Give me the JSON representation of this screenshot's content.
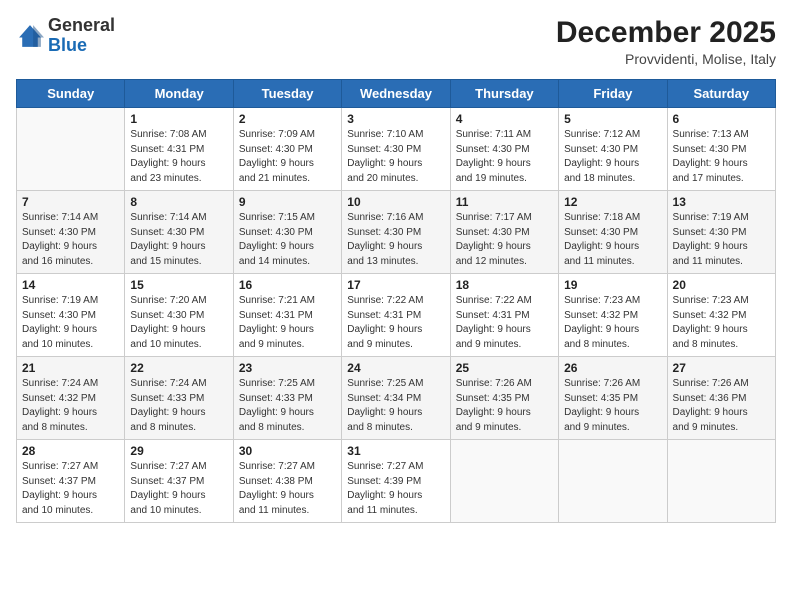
{
  "header": {
    "logo_general": "General",
    "logo_blue": "Blue",
    "month_title": "December 2025",
    "subtitle": "Provvidenti, Molise, Italy"
  },
  "days_of_week": [
    "Sunday",
    "Monday",
    "Tuesday",
    "Wednesday",
    "Thursday",
    "Friday",
    "Saturday"
  ],
  "weeks": [
    [
      {
        "day": "",
        "info": ""
      },
      {
        "day": "1",
        "info": "Sunrise: 7:08 AM\nSunset: 4:31 PM\nDaylight: 9 hours\nand 23 minutes."
      },
      {
        "day": "2",
        "info": "Sunrise: 7:09 AM\nSunset: 4:30 PM\nDaylight: 9 hours\nand 21 minutes."
      },
      {
        "day": "3",
        "info": "Sunrise: 7:10 AM\nSunset: 4:30 PM\nDaylight: 9 hours\nand 20 minutes."
      },
      {
        "day": "4",
        "info": "Sunrise: 7:11 AM\nSunset: 4:30 PM\nDaylight: 9 hours\nand 19 minutes."
      },
      {
        "day": "5",
        "info": "Sunrise: 7:12 AM\nSunset: 4:30 PM\nDaylight: 9 hours\nand 18 minutes."
      },
      {
        "day": "6",
        "info": "Sunrise: 7:13 AM\nSunset: 4:30 PM\nDaylight: 9 hours\nand 17 minutes."
      }
    ],
    [
      {
        "day": "7",
        "info": "Sunrise: 7:14 AM\nSunset: 4:30 PM\nDaylight: 9 hours\nand 16 minutes."
      },
      {
        "day": "8",
        "info": "Sunrise: 7:14 AM\nSunset: 4:30 PM\nDaylight: 9 hours\nand 15 minutes."
      },
      {
        "day": "9",
        "info": "Sunrise: 7:15 AM\nSunset: 4:30 PM\nDaylight: 9 hours\nand 14 minutes."
      },
      {
        "day": "10",
        "info": "Sunrise: 7:16 AM\nSunset: 4:30 PM\nDaylight: 9 hours\nand 13 minutes."
      },
      {
        "day": "11",
        "info": "Sunrise: 7:17 AM\nSunset: 4:30 PM\nDaylight: 9 hours\nand 12 minutes."
      },
      {
        "day": "12",
        "info": "Sunrise: 7:18 AM\nSunset: 4:30 PM\nDaylight: 9 hours\nand 11 minutes."
      },
      {
        "day": "13",
        "info": "Sunrise: 7:19 AM\nSunset: 4:30 PM\nDaylight: 9 hours\nand 11 minutes."
      }
    ],
    [
      {
        "day": "14",
        "info": "Sunrise: 7:19 AM\nSunset: 4:30 PM\nDaylight: 9 hours\nand 10 minutes."
      },
      {
        "day": "15",
        "info": "Sunrise: 7:20 AM\nSunset: 4:30 PM\nDaylight: 9 hours\nand 10 minutes."
      },
      {
        "day": "16",
        "info": "Sunrise: 7:21 AM\nSunset: 4:31 PM\nDaylight: 9 hours\nand 9 minutes."
      },
      {
        "day": "17",
        "info": "Sunrise: 7:22 AM\nSunset: 4:31 PM\nDaylight: 9 hours\nand 9 minutes."
      },
      {
        "day": "18",
        "info": "Sunrise: 7:22 AM\nSunset: 4:31 PM\nDaylight: 9 hours\nand 9 minutes."
      },
      {
        "day": "19",
        "info": "Sunrise: 7:23 AM\nSunset: 4:32 PM\nDaylight: 9 hours\nand 8 minutes."
      },
      {
        "day": "20",
        "info": "Sunrise: 7:23 AM\nSunset: 4:32 PM\nDaylight: 9 hours\nand 8 minutes."
      }
    ],
    [
      {
        "day": "21",
        "info": "Sunrise: 7:24 AM\nSunset: 4:32 PM\nDaylight: 9 hours\nand 8 minutes."
      },
      {
        "day": "22",
        "info": "Sunrise: 7:24 AM\nSunset: 4:33 PM\nDaylight: 9 hours\nand 8 minutes."
      },
      {
        "day": "23",
        "info": "Sunrise: 7:25 AM\nSunset: 4:33 PM\nDaylight: 9 hours\nand 8 minutes."
      },
      {
        "day": "24",
        "info": "Sunrise: 7:25 AM\nSunset: 4:34 PM\nDaylight: 9 hours\nand 8 minutes."
      },
      {
        "day": "25",
        "info": "Sunrise: 7:26 AM\nSunset: 4:35 PM\nDaylight: 9 hours\nand 9 minutes."
      },
      {
        "day": "26",
        "info": "Sunrise: 7:26 AM\nSunset: 4:35 PM\nDaylight: 9 hours\nand 9 minutes."
      },
      {
        "day": "27",
        "info": "Sunrise: 7:26 AM\nSunset: 4:36 PM\nDaylight: 9 hours\nand 9 minutes."
      }
    ],
    [
      {
        "day": "28",
        "info": "Sunrise: 7:27 AM\nSunset: 4:37 PM\nDaylight: 9 hours\nand 10 minutes."
      },
      {
        "day": "29",
        "info": "Sunrise: 7:27 AM\nSunset: 4:37 PM\nDaylight: 9 hours\nand 10 minutes."
      },
      {
        "day": "30",
        "info": "Sunrise: 7:27 AM\nSunset: 4:38 PM\nDaylight: 9 hours\nand 11 minutes."
      },
      {
        "day": "31",
        "info": "Sunrise: 7:27 AM\nSunset: 4:39 PM\nDaylight: 9 hours\nand 11 minutes."
      },
      {
        "day": "",
        "info": ""
      },
      {
        "day": "",
        "info": ""
      },
      {
        "day": "",
        "info": ""
      }
    ]
  ]
}
